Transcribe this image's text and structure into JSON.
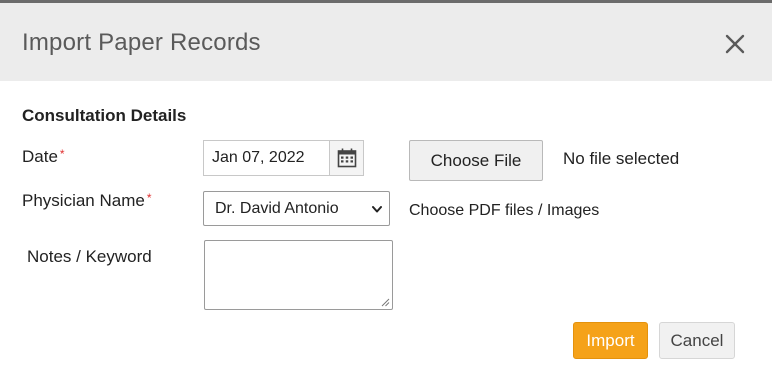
{
  "dialog": {
    "title": "Import Paper Records",
    "close_icon": "close-icon"
  },
  "section": {
    "title": "Consultation Details"
  },
  "form": {
    "date_label": "Date",
    "date_required": "*",
    "date_value": "Jan 07, 2022",
    "calendar_icon": "calendar-icon",
    "physician_label": "Physician Name",
    "physician_required": "*",
    "physician_selected": "Dr. David Antonio",
    "notes_label": "Notes / Keyword",
    "notes_value": ""
  },
  "file": {
    "choose_label": "Choose File",
    "status": "No file selected",
    "hint": "Choose PDF files / Images"
  },
  "actions": {
    "import_label": "Import",
    "cancel_label": "Cancel"
  },
  "colors": {
    "primary": "#f5a219",
    "required": "#e03030",
    "header_bg": "#ececec"
  }
}
